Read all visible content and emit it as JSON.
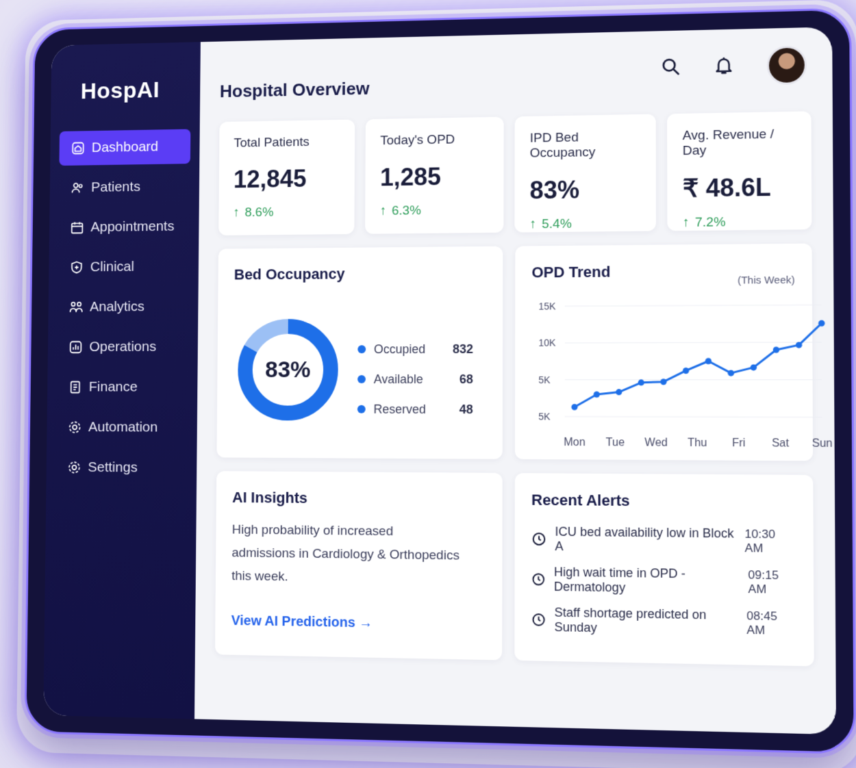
{
  "brand": "HospAI",
  "nav": [
    {
      "label": "Dashboard",
      "icon": "dashboard-icon",
      "active": true
    },
    {
      "label": "Patients",
      "icon": "patients-icon"
    },
    {
      "label": "Appointments",
      "icon": "calendar-icon"
    },
    {
      "label": "Clinical",
      "icon": "shield-icon"
    },
    {
      "label": "Analytics",
      "icon": "analytics-icon"
    },
    {
      "label": "Operations",
      "icon": "operations-icon"
    },
    {
      "label": "Finance",
      "icon": "finance-icon"
    },
    {
      "label": "Automation",
      "icon": "gear-icon"
    },
    {
      "label": "Settings",
      "icon": "gear-icon"
    }
  ],
  "header": {
    "title": "Hospital Overview"
  },
  "kpis": [
    {
      "label": "Total Patients",
      "value": "12,845",
      "change": "8.6%"
    },
    {
      "label": "Today's OPD",
      "value": "1,285",
      "change": "6.3%"
    },
    {
      "label": "IPD Bed Occupancy",
      "value": "83%",
      "change": "5.4%"
    },
    {
      "label": "Avg. Revenue / Day",
      "value": "₹ 48.6L",
      "change": "7.2%"
    }
  ],
  "bed_occupancy": {
    "title": "Bed Occupancy",
    "percent_label": "83%",
    "percent": 0.83,
    "legend": [
      {
        "label": "Occupied",
        "value": "832"
      },
      {
        "label": "Available",
        "value": "68"
      },
      {
        "label": "Reserved",
        "value": "48"
      }
    ]
  },
  "opd_trend": {
    "title": "OPD Trend",
    "subtitle": "(This Week)"
  },
  "chart_data": {
    "type": "line",
    "x": [
      "Mon",
      "Tue",
      "Wed",
      "Thu",
      "Fri",
      "Sat",
      "Sun"
    ],
    "y_tick_labels": [
      "15K",
      "10K",
      "5K",
      "5K"
    ],
    "series": [
      {
        "values": [
          3200,
          4800,
          5100,
          6300,
          6400,
          7800,
          9000,
          7500,
          8200,
          10400,
          11000,
          13700
        ]
      }
    ],
    "color": "#1e6fe8"
  },
  "ai_insights": {
    "title": "AI Insights",
    "text": "High probability of increased admissions in Cardiology & Orthopedics this week.",
    "link": "View AI Predictions →"
  },
  "alerts": {
    "title": "Recent Alerts",
    "items": [
      {
        "text": "ICU bed availability low in Block A",
        "time": "10:30 AM"
      },
      {
        "text": "High wait time in OPD - Dermatology",
        "time": "09:15 AM"
      },
      {
        "text": "Staff shortage predicted on Sunday",
        "time": "08:45 AM"
      }
    ]
  },
  "colors": {
    "accent": "#5b3df5",
    "sidebar": "#1a1950",
    "positive": "#2e9d5a",
    "series": "#1e6fe8"
  }
}
